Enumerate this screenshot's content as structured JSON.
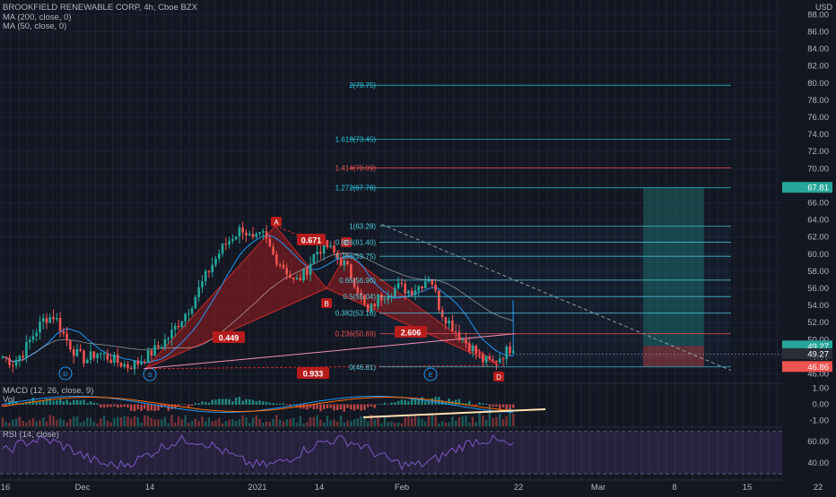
{
  "header": {
    "title": "BROOKFIELD RENEWABLE CORP, 4h, Cboe BZX",
    "ma200": "MA (200, close, 0)",
    "ma50": "MA (50, close, 0)",
    "macd": "MACD (12, 26, close, 9)",
    "vol": "Vol",
    "rsi": "RSI (14, close)"
  },
  "chart_data": {
    "type": "candlestick",
    "symbol": "BROOKFIELD RENEWABLE CORP",
    "interval": "4h",
    "exchange": "Cboe BZX",
    "currency": "USD",
    "ylim": [
      46,
      90
    ],
    "y_ticks": [
      88.0,
      86.0,
      84.0,
      82.0,
      80.0,
      78.0,
      76.0,
      74.0,
      72.0,
      70.0,
      68.0,
      66.0,
      64.0,
      62.0,
      60.0,
      58.0,
      56.0,
      54.0,
      52.0,
      50.0,
      48.0,
      46.0
    ],
    "x_ticks": [
      "16",
      "Dec",
      "14",
      "2021",
      "14",
      "Feb",
      "22",
      "Mar",
      "8",
      "15",
      "22"
    ],
    "close_path": [
      48,
      47.3,
      48.6,
      50.7,
      52.5,
      52.8,
      50.2,
      48.4,
      47.6,
      48.5,
      48.0,
      47.4,
      46.9,
      47.3,
      48.2,
      49.2,
      50.4,
      52.2,
      53.9,
      56.3,
      58.6,
      60.6,
      62.0,
      63.1,
      61.5,
      62.2,
      59.8,
      58.5,
      56.6,
      57.8,
      60.2,
      61.1,
      59.8,
      58.5,
      56.2,
      53.0,
      54.8,
      55.6,
      56.2,
      55.7,
      56.3,
      57.6,
      53.4,
      51.8,
      50.2,
      49.1,
      47.6,
      47.3,
      48.3,
      49.3
    ],
    "harmonic_points": [
      {
        "label": "A",
        "price": 63.3
      },
      {
        "label": "B",
        "price": 56.0
      },
      {
        "label": "C",
        "price": 60.0
      },
      {
        "label": "D",
        "price": 47.0
      }
    ],
    "harmonic_ratios": [
      "0.449",
      "0.671",
      "2.606",
      "0.933"
    ],
    "pattern_markers": [
      "D",
      "S",
      "E"
    ],
    "fib_levels": [
      {
        "label": "2(79.75)",
        "price": 79.75
      },
      {
        "label": "1.618(73.45)",
        "price": 73.45
      },
      {
        "label": "1.414(70.09)",
        "price": 70.09
      },
      {
        "label": "1.272(67.76)",
        "price": 67.76
      },
      {
        "label": "1(63.28)",
        "price": 63.28
      },
      {
        "label": "0.886(61.40)",
        "price": 61.4
      },
      {
        "label": "0.786(59.75)",
        "price": 59.75
      },
      {
        "label": "0.65(56.96)",
        "price": 56.96
      },
      {
        "label": "0.5(55.04)",
        "price": 55.04
      },
      {
        "label": "0.382(53.10)",
        "price": 53.1
      },
      {
        "label": "0.236(50.69)",
        "price": 50.69
      },
      {
        "label": "0(46.81)",
        "price": 46.81
      }
    ],
    "long_position": {
      "entry": 49.27,
      "target": 67.81,
      "stop": 46.86
    },
    "price_labels": [
      {
        "text": "67.81",
        "price": 67.81,
        "color": "#26a69a"
      },
      {
        "text": "49.27",
        "price": 49.27,
        "color": "#26a69a"
      },
      {
        "text": "49.27",
        "price": 48.37,
        "color": "#2a2e39"
      },
      {
        "text": "46.86",
        "price": 46.86,
        "color": "#ef5350"
      }
    ],
    "macd_ticks": [
      "1.00",
      "0.00",
      "-1.00"
    ],
    "rsi_ticks": [
      "60.00",
      "40.00"
    ],
    "colors": {
      "up": "#26a69a",
      "down": "#ef5350",
      "fib": "#2196f3",
      "pattern": "#b71c1c",
      "rsi": "#7e57c2",
      "ma50": "#2196f3"
    }
  }
}
